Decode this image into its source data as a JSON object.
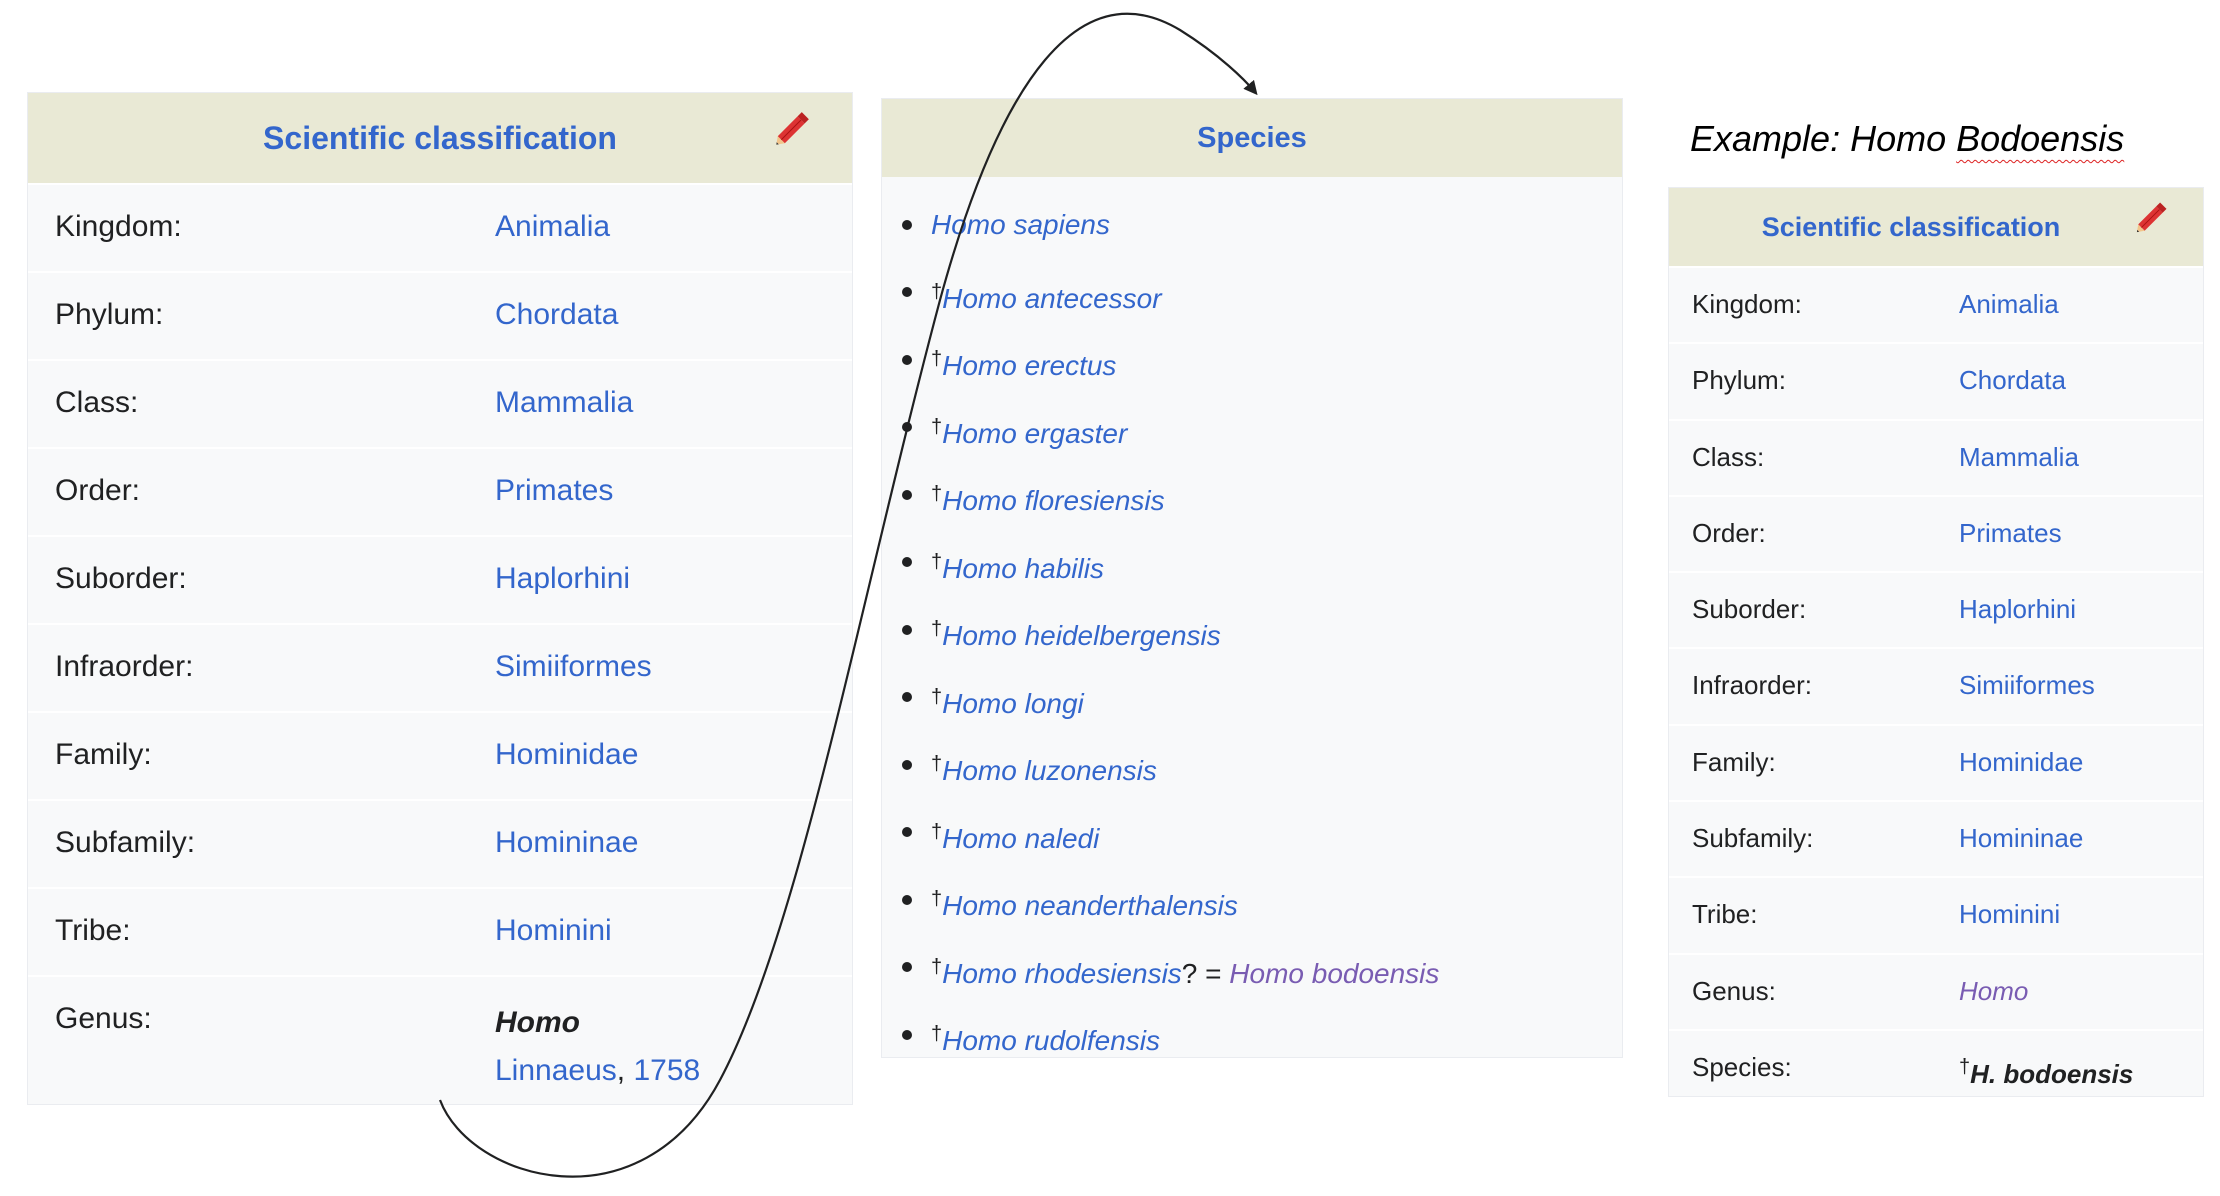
{
  "left_box": {
    "title": "Scientific classification",
    "rows": [
      {
        "label": "Kingdom:",
        "value": "Animalia"
      },
      {
        "label": "Phylum:",
        "value": "Chordata"
      },
      {
        "label": "Class:",
        "value": "Mammalia"
      },
      {
        "label": "Order:",
        "value": "Primates"
      },
      {
        "label": "Suborder:",
        "value": "Haplorhini"
      },
      {
        "label": "Infraorder:",
        "value": "Simiiformes"
      },
      {
        "label": "Family:",
        "value": "Hominidae"
      },
      {
        "label": "Subfamily:",
        "value": "Homininae"
      },
      {
        "label": "Tribe:",
        "value": "Hominini"
      }
    ],
    "genus": {
      "label": "Genus:",
      "name": "Homo",
      "author": "Linnaeus",
      "separator": ", ",
      "year": "1758"
    }
  },
  "species_box": {
    "title": "Species",
    "dagger": "†",
    "items": [
      {
        "name": "Homo sapiens",
        "extinct": false
      },
      {
        "name": "Homo antecessor",
        "extinct": true
      },
      {
        "name": "Homo erectus",
        "extinct": true
      },
      {
        "name": "Homo ergaster",
        "extinct": true
      },
      {
        "name": "Homo floresiensis",
        "extinct": true
      },
      {
        "name": "Homo habilis",
        "extinct": true
      },
      {
        "name": "Homo heidelbergensis",
        "extinct": true
      },
      {
        "name": "Homo longi",
        "extinct": true
      },
      {
        "name": "Homo luzonensis",
        "extinct": true
      },
      {
        "name": "Homo naledi",
        "extinct": true
      },
      {
        "name": "Homo neanderthalensis",
        "extinct": true
      },
      {
        "name": "Homo rhodesiensis",
        "extinct": true,
        "suffix": "? = ",
        "alias": "Homo bodoensis"
      },
      {
        "name": "Homo rudolfensis",
        "extinct": true
      }
    ]
  },
  "example": {
    "prefix": "Example: Homo ",
    "underlined": "Bodoensis"
  },
  "right_box": {
    "title": "Scientific classification",
    "rows": [
      {
        "label": "Kingdom:",
        "value": "Animalia"
      },
      {
        "label": "Phylum:",
        "value": "Chordata"
      },
      {
        "label": "Class:",
        "value": "Mammalia"
      },
      {
        "label": "Order:",
        "value": "Primates"
      },
      {
        "label": "Suborder:",
        "value": "Haplorhini"
      },
      {
        "label": "Infraorder:",
        "value": "Simiiformes"
      },
      {
        "label": "Family:",
        "value": "Hominidae"
      },
      {
        "label": "Subfamily:",
        "value": "Homininae"
      },
      {
        "label": "Tribe:",
        "value": "Hominini"
      }
    ],
    "genus": {
      "label": "Genus:",
      "value": "Homo"
    },
    "species": {
      "label": "Species:",
      "dagger": "†",
      "value": "H. bodoensis"
    }
  },
  "colors": {
    "link": "#3366cc",
    "visited_link": "#795cb2",
    "header_bg": "#e9e9d5",
    "box_bg": "#f8f9fa",
    "pencil": "#d33"
  },
  "icons": {
    "edit": "pencil-icon",
    "connector": "curved-arrow"
  }
}
